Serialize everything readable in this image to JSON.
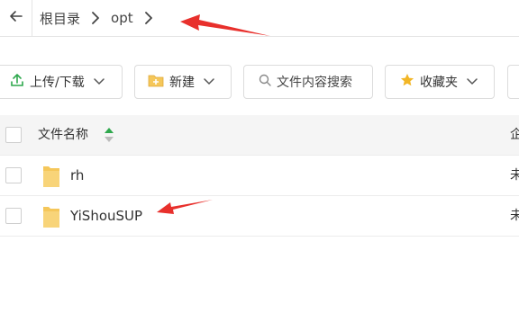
{
  "breadcrumb": {
    "items": [
      "根目录",
      "opt"
    ]
  },
  "toolbar": {
    "upload_download_label": "上传/下载",
    "new_label": "新建",
    "search_placeholder": "文件内容搜索",
    "favorites_label": "收藏夹"
  },
  "table": {
    "header_name": "文件名称",
    "header_right_partial": "企",
    "rows": [
      {
        "name": "rh",
        "right_partial": "未"
      },
      {
        "name": "YiShouSUP",
        "right_partial": "未"
      }
    ]
  },
  "icons": {
    "back": "back-arrow-icon",
    "chevron": "chevron-right-icon",
    "upload": "upload-icon",
    "new_folder": "new-folder-icon",
    "search": "search-icon",
    "star": "star-icon",
    "folder": "folder-icon"
  },
  "colors": {
    "annotation_arrow": "#e8302c",
    "folder": "#f5c75a",
    "star": "#f2b626",
    "sort_up": "#2ea84d",
    "upload": "#2ea84d"
  }
}
